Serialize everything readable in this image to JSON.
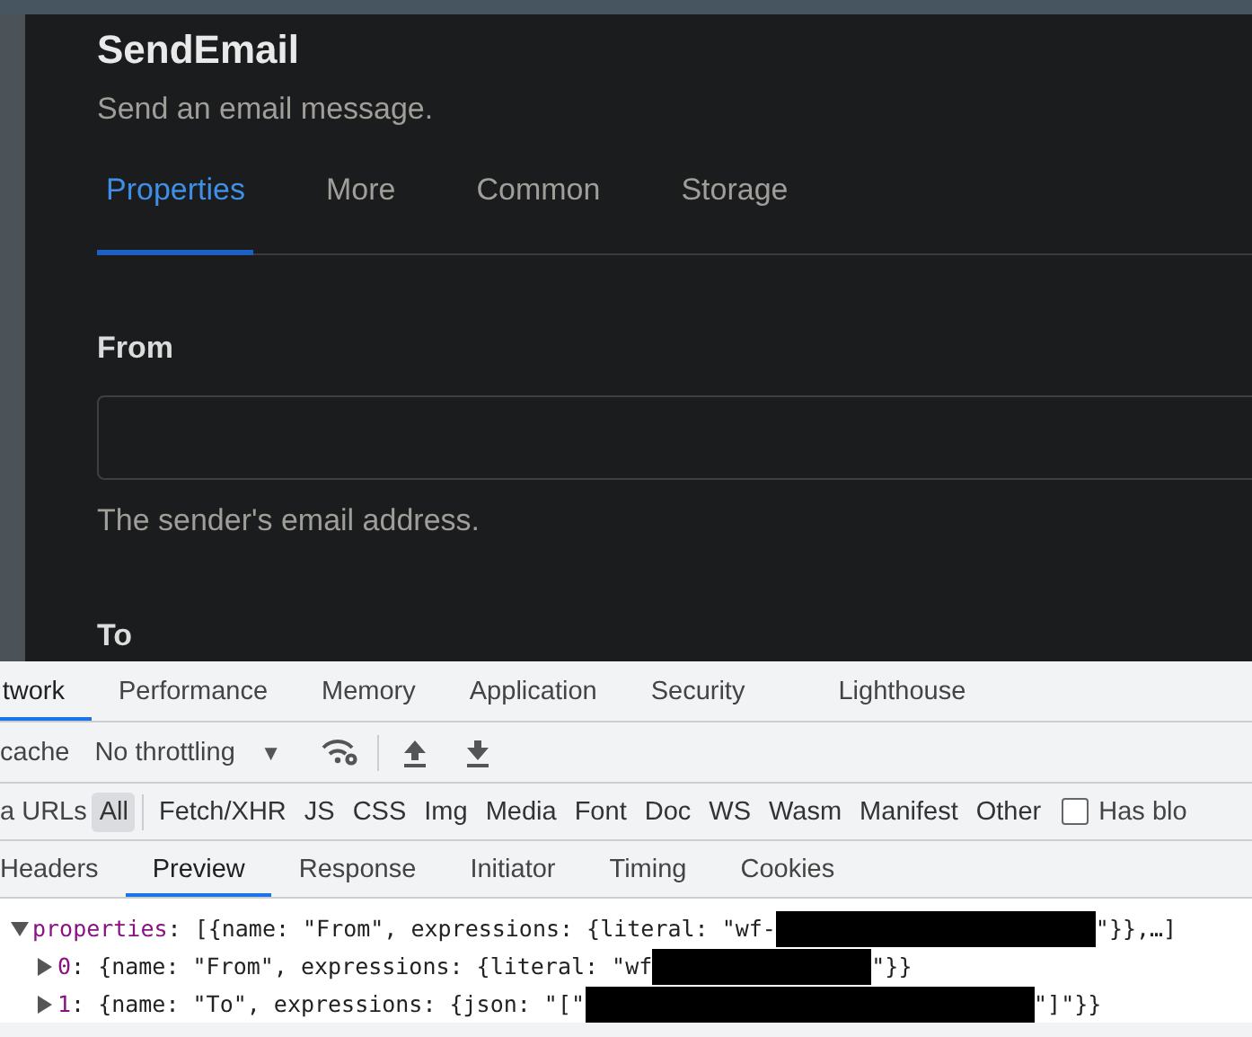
{
  "editor": {
    "title": "SendEmail",
    "description": "Send an email message.",
    "tabs": [
      {
        "label": "Properties",
        "selected": true
      },
      {
        "label": "More",
        "selected": false
      },
      {
        "label": "Common",
        "selected": false
      },
      {
        "label": "Storage",
        "selected": false
      }
    ],
    "fields": [
      {
        "label": "From",
        "hint": "The sender's email address."
      },
      {
        "label": "To"
      }
    ]
  },
  "devtools": {
    "tabs": [
      {
        "label": "twork",
        "selected": true
      },
      {
        "label": "Performance",
        "selected": false
      },
      {
        "label": "Memory",
        "selected": false
      },
      {
        "label": "Application",
        "selected": false
      },
      {
        "label": "Security",
        "selected": false
      },
      {
        "label": "Lighthouse",
        "selected": false
      }
    ],
    "toolbar": {
      "cache_label": "cache",
      "throttling": "No throttling",
      "caret": "▼"
    },
    "filter_label": "a URLs",
    "filters": [
      {
        "label": "All",
        "selected": true
      },
      {
        "label": "Fetch/XHR",
        "selected": false
      },
      {
        "label": "JS",
        "selected": false
      },
      {
        "label": "CSS",
        "selected": false
      },
      {
        "label": "Img",
        "selected": false
      },
      {
        "label": "Media",
        "selected": false
      },
      {
        "label": "Font",
        "selected": false
      },
      {
        "label": "Doc",
        "selected": false
      },
      {
        "label": "WS",
        "selected": false
      },
      {
        "label": "Wasm",
        "selected": false
      },
      {
        "label": "Manifest",
        "selected": false
      },
      {
        "label": "Other",
        "selected": false
      }
    ],
    "blocked_checkbox": {
      "label": "Has blo",
      "checked": false
    },
    "detail_tabs": [
      {
        "label": "Headers",
        "selected": false
      },
      {
        "label": "Preview",
        "selected": true
      },
      {
        "label": "Response",
        "selected": false
      },
      {
        "label": "Initiator",
        "selected": false
      },
      {
        "label": "Timing",
        "selected": false
      },
      {
        "label": "Cookies",
        "selected": false
      }
    ],
    "preview": [
      {
        "key": "properties",
        "expanded": true,
        "before": ": [{name: \"From\", expressions: {literal: \"wf-",
        "redacted": true,
        "after": "\"}},…]",
        "children": [
          {
            "key": "0",
            "expanded": false,
            "before": ": {name: \"From\", expressions: {literal: \"wf",
            "redacted": true,
            "after": "\"}}"
          },
          {
            "key": "1",
            "expanded": false,
            "before": ": {name: \"To\", expressions: {json: \"[\"",
            "redacted": true,
            "after": "\"]\"}}"
          }
        ]
      }
    ]
  }
}
